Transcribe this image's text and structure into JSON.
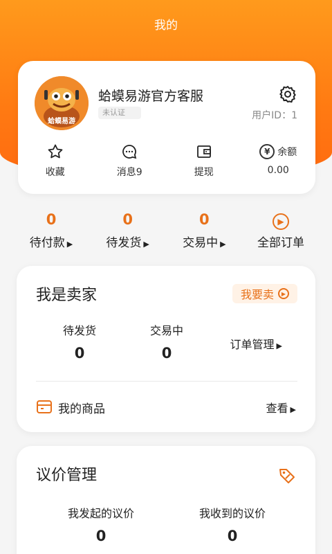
{
  "header": {
    "title": "我的"
  },
  "profile": {
    "name": "蛤蟆易游官方客服",
    "badge": "未认证",
    "avatar_text": "蛤蟆易游",
    "user_id": "用户ID：1",
    "stats": [
      {
        "icon": "star-icon",
        "label": "收藏"
      },
      {
        "icon": "message-icon",
        "label": "消息9"
      },
      {
        "icon": "wallet-icon",
        "label": "提现"
      }
    ],
    "balance": {
      "label": "余额",
      "value": "0.00",
      "symbol": "¥"
    }
  },
  "orders": [
    {
      "count": "0",
      "label": "待付款"
    },
    {
      "count": "0",
      "label": "待发货"
    },
    {
      "count": "0",
      "label": "交易中"
    },
    {
      "label": "全部订单"
    }
  ],
  "seller": {
    "title": "我是卖家",
    "sell_button": "我要卖",
    "stats": [
      {
        "label": "待发货",
        "value": "0"
      },
      {
        "label": "交易中",
        "value": "0"
      }
    ],
    "order_manage": "订单管理",
    "goods_label": "我的商品",
    "goods_view": "查看"
  },
  "bargain": {
    "title": "议价管理",
    "stats": [
      {
        "label": "我发起的议价",
        "value": "0"
      },
      {
        "label": "我收到的议价",
        "value": "0"
      }
    ]
  },
  "colors": {
    "accent": "#e8711a",
    "hero": "#ff8a16"
  }
}
